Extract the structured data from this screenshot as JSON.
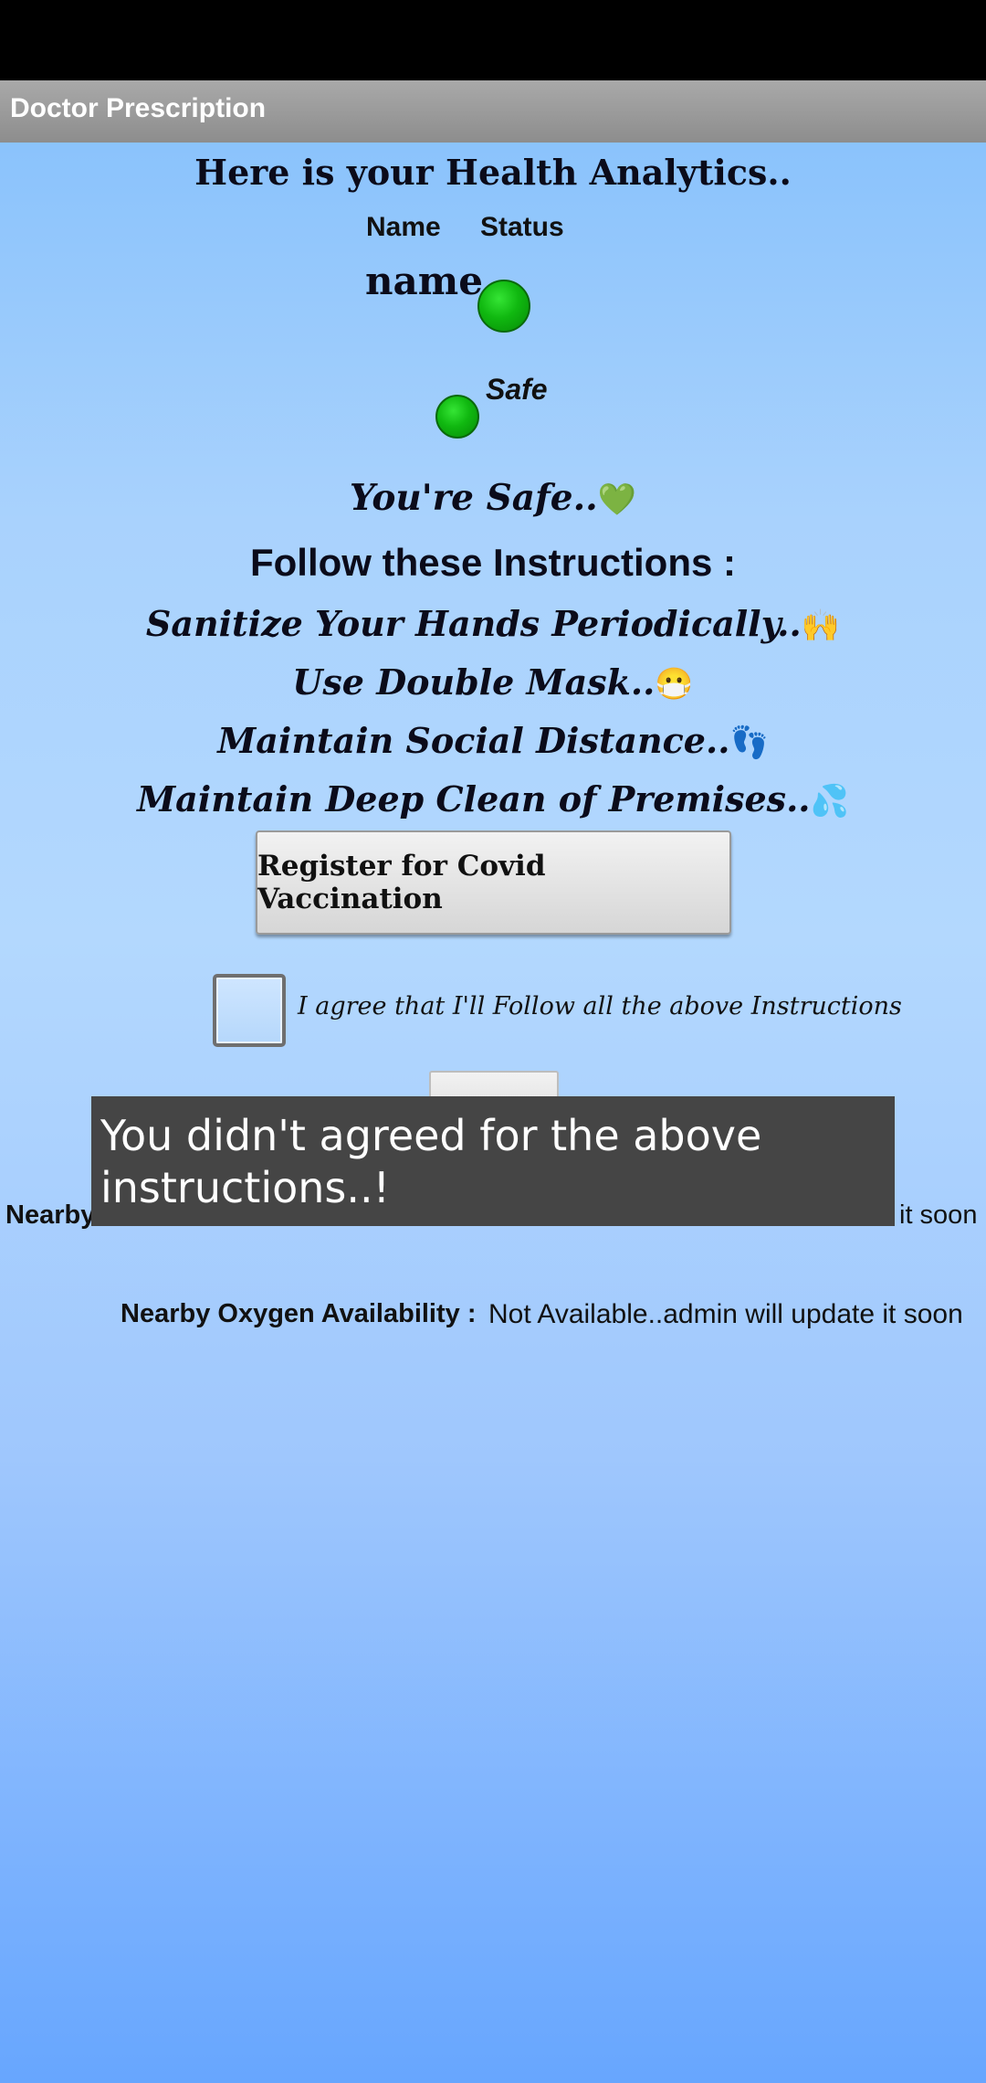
{
  "app": {
    "title": "Doctor Prescription"
  },
  "header": {
    "headline": "Here is your Health Analytics.."
  },
  "table": {
    "col_name": "Name",
    "col_status": "Status",
    "name_value": "name",
    "status_label": "Safe"
  },
  "status_color": "#10b810",
  "message": {
    "safe": "You're Safe..",
    "safe_emoji": "💚",
    "follow": "Follow these Instructions :"
  },
  "instructions": [
    {
      "text": "Sanitize Your Hands Periodically..",
      "emoji": "🙌"
    },
    {
      "text": "Use Double Mask..",
      "emoji": "😷"
    },
    {
      "text": "Maintain Social Distance..",
      "emoji": "👣"
    },
    {
      "text": "Maintain Deep Clean of Premises..",
      "emoji": "💦"
    }
  ],
  "register_button": "Register for Covid Vaccination",
  "agreement": {
    "label": "I agree that I'll Follow all the above Instructions",
    "checked": false
  },
  "availability": {
    "row1_label_visible": "Nearby",
    "row1_value_visible": "it soon",
    "oxygen_label": "Nearby Oxygen Availability :",
    "oxygen_value": "Not Available..admin will update it soon"
  },
  "toast": {
    "text": "You didn't agreed for the above instructions..!"
  }
}
